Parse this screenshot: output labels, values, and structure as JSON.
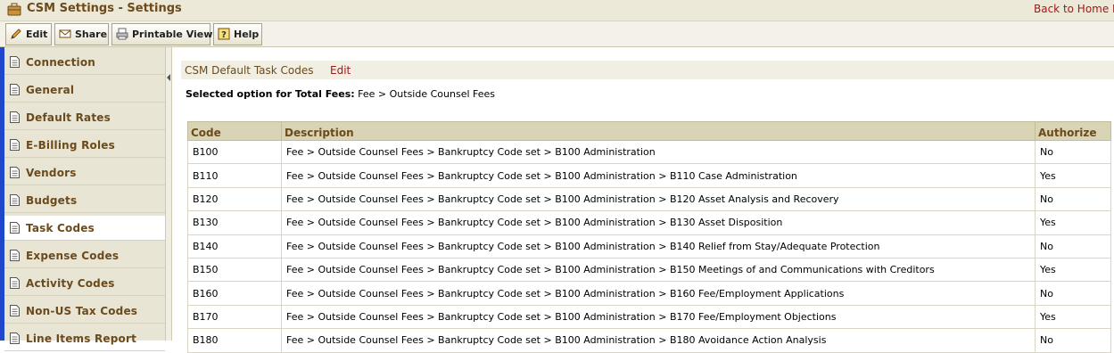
{
  "window": {
    "title": "CSM Settings - Settings",
    "home_link": "Back to Home P"
  },
  "toolbar": {
    "edit": "Edit",
    "share": "Share",
    "printable_view": "Printable View",
    "help": "Help"
  },
  "sidebar": {
    "items": [
      {
        "label": "Connection",
        "active": false
      },
      {
        "label": "General",
        "active": false
      },
      {
        "label": "Default Rates",
        "active": false
      },
      {
        "label": "E-Billing Roles",
        "active": false
      },
      {
        "label": "Vendors",
        "active": false
      },
      {
        "label": "Budgets",
        "active": false
      },
      {
        "label": "Task Codes",
        "active": true
      },
      {
        "label": "Expense Codes",
        "active": false
      },
      {
        "label": "Activity Codes",
        "active": false
      },
      {
        "label": "Non-US Tax Codes",
        "active": false
      },
      {
        "label": "Line Items Report",
        "active": false
      }
    ]
  },
  "section": {
    "title": "CSM Default Task Codes",
    "edit": "Edit"
  },
  "selected_option": {
    "label": "Selected option for Total Fees:",
    "value": "Fee > Outside Counsel Fees"
  },
  "table": {
    "headers": [
      "Code",
      "Description",
      "Authorize"
    ],
    "rows": [
      [
        "B100",
        "Fee > Outside Counsel Fees > Bankruptcy Code set > B100 Administration",
        "No"
      ],
      [
        "B110",
        "Fee > Outside Counsel Fees > Bankruptcy Code set > B100 Administration > B110 Case Administration",
        "Yes"
      ],
      [
        "B120",
        "Fee > Outside Counsel Fees > Bankruptcy Code set > B100 Administration > B120 Asset Analysis and Recovery",
        "No"
      ],
      [
        "B130",
        "Fee > Outside Counsel Fees > Bankruptcy Code set > B100 Administration > B130 Asset Disposition",
        "Yes"
      ],
      [
        "B140",
        "Fee > Outside Counsel Fees > Bankruptcy Code set > B100 Administration > B140 Relief from Stay/Adequate Protection",
        "No"
      ],
      [
        "B150",
        "Fee > Outside Counsel Fees > Bankruptcy Code set > B100 Administration > B150 Meetings of and Communications with Creditors",
        "Yes"
      ],
      [
        "B160",
        "Fee > Outside Counsel Fees > Bankruptcy Code set > B100 Administration > B160 Fee/Employment Applications",
        "No"
      ],
      [
        "B170",
        "Fee > Outside Counsel Fees > Bankruptcy Code set > B100 Administration > B170 Fee/Employment Objections",
        "Yes"
      ],
      [
        "B180",
        "Fee > Outside Counsel Fees > Bankruptcy Code set > B100 Administration > B180 Avoidance Action Analysis",
        "No"
      ]
    ]
  },
  "colors": {
    "accent_brown": "#6b4a1c",
    "link_red": "#a01818",
    "sidebar_bar_blue": "#1f47cc"
  }
}
